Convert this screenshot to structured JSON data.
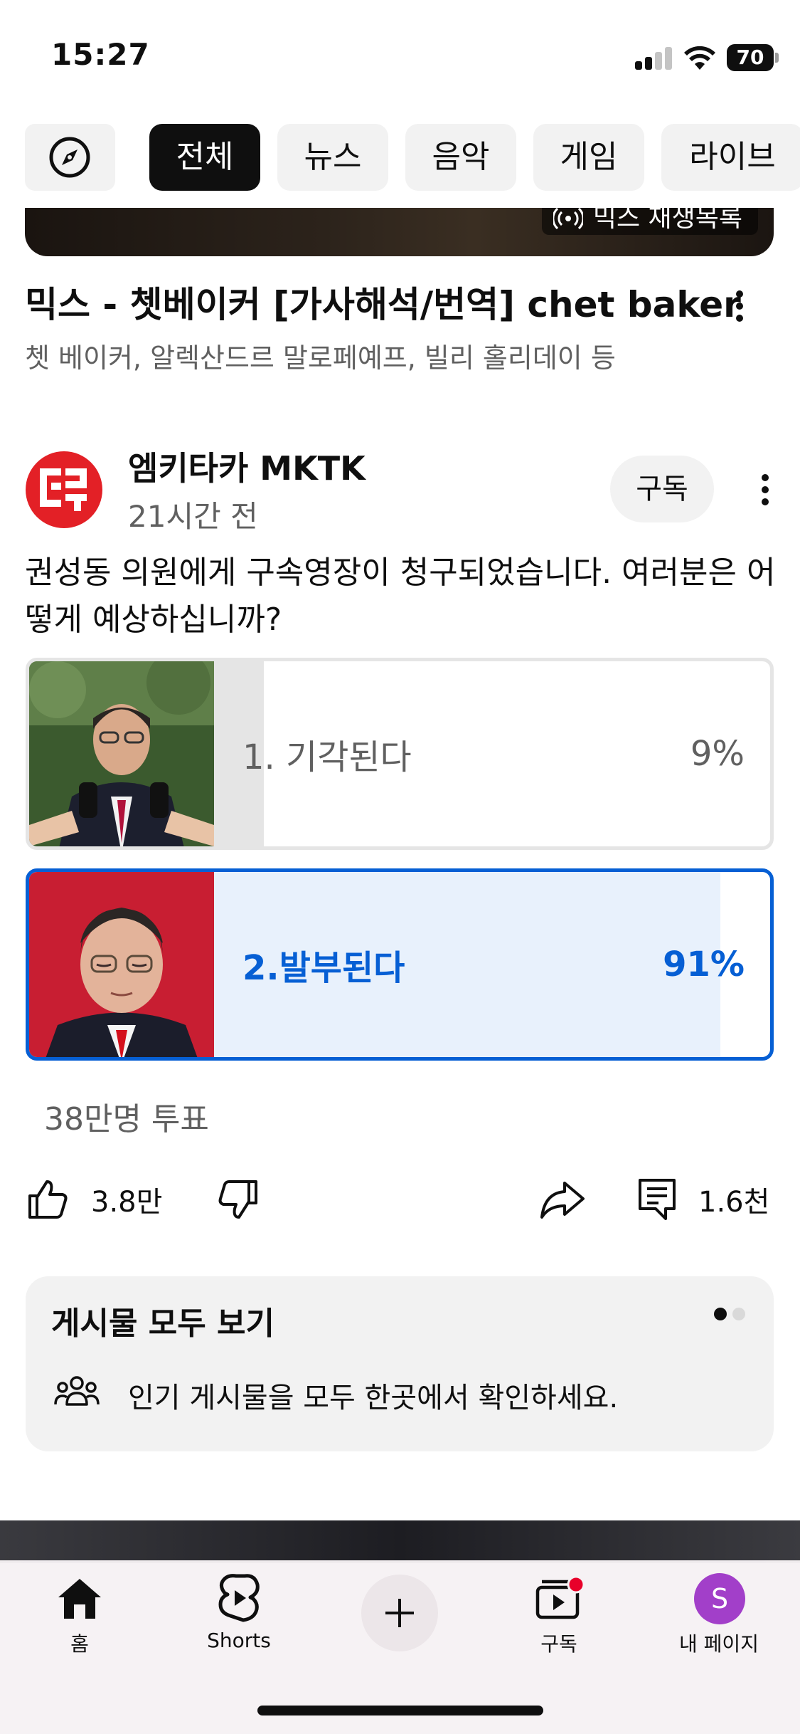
{
  "status_bar": {
    "time": "15:27",
    "battery": "70"
  },
  "chips": [
    "전체",
    "뉴스",
    "음악",
    "게임",
    "라이브"
  ],
  "video": {
    "badge": "믹스 재생목록",
    "title": "믹스 - 쳇베이커 [가사해석/번역] chet baker",
    "subtitle": "쳇 베이커, 알렉산드르 말로페예프, 빌리 홀리데이 등"
  },
  "post": {
    "channel": "엠키타카 MKTK",
    "time_ago": "21시간 전",
    "subscribe_label": "구독",
    "text": "권성동 의원에게 구속영장이 청구되었습니다. 여러분은 어떻게 예상하십니까?",
    "poll": {
      "options": [
        {
          "label": "1. 기각된다",
          "percent_text": "9%",
          "fraction": 0.09
        },
        {
          "label": "2.발부된다",
          "percent_text": "91%",
          "fraction": 0.91
        }
      ],
      "votes": "38만명 투표"
    },
    "actions": {
      "likes": "3.8만",
      "comments": "1.6천"
    }
  },
  "see_all_card": {
    "title": "게시물 모두 보기",
    "description": "인기 게시물을 모두 한곳에서 확인하세요."
  },
  "bottom_nav": {
    "home": "홈",
    "shorts": "Shorts",
    "subscriptions": "구독",
    "profile": "내 페이지",
    "profile_initial": "S"
  },
  "colors": {
    "accent": "#065fd4",
    "brand_red": "#e32026",
    "profile_avatar": "#a23fc9",
    "notification": "#e8002a"
  }
}
